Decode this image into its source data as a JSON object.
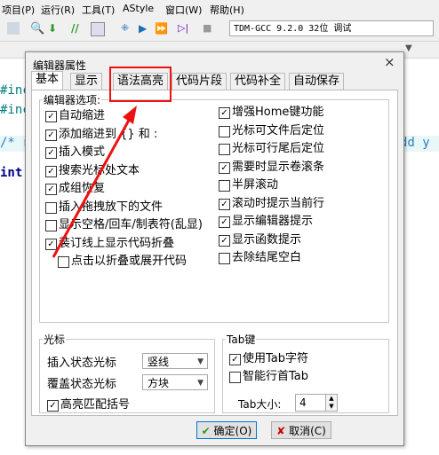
{
  "ide": {
    "menu": [
      "项目(P)",
      "运行(R)",
      "工具(T)",
      "AStyle",
      "窗口(W)",
      "帮助(H)"
    ],
    "compiler": "TDM-GCC 9.2.0 32位 调试",
    "code_fragments": [
      "#inc",
      "#inc",
      "/* r",
      "int",
      "dd y"
    ]
  },
  "dialog": {
    "title": "编辑器属性",
    "close_symbol": "×",
    "tabs": [
      "基本",
      "显示",
      "语法高亮",
      "代码片段",
      "代码补全",
      "自动保存"
    ],
    "active_tab": "基本",
    "highlighted_tab": "语法高亮",
    "editor_options": {
      "title": "编辑器选项:",
      "left": [
        {
          "label": "自动缩进",
          "checked": true
        },
        {
          "label": "添加缩进到 {} 和 :",
          "checked": true
        },
        {
          "label": "插入模式",
          "checked": true
        },
        {
          "label": "搜索光标处文本",
          "checked": true
        },
        {
          "label": "成组恢复",
          "checked": true
        },
        {
          "label": "插入拖拽放下的文件",
          "checked": false
        },
        {
          "label": "显示空格/回车/制表符(乱显)",
          "checked": false
        },
        {
          "label": "装订线上显示代码折叠",
          "checked": true
        },
        {
          "label": "点击以折叠或展开代码",
          "checked": false
        }
      ],
      "right": [
        {
          "label": "增强Home键功能",
          "checked": true
        },
        {
          "label": "光标可文件后定位",
          "checked": false
        },
        {
          "label": "光标可行尾后定位",
          "checked": false
        },
        {
          "label": "需要时显示卷滚条",
          "checked": true
        },
        {
          "label": "半屏滚动",
          "checked": false
        },
        {
          "label": "滚动时提示当前行",
          "checked": true
        },
        {
          "label": "显示编辑器提示",
          "checked": true
        },
        {
          "label": "显示函数提示",
          "checked": true
        },
        {
          "label": "去除结尾空白",
          "checked": false
        }
      ]
    },
    "cursor": {
      "title": "光标",
      "insert_label": "插入状态光标",
      "insert_value": "竖线",
      "overwrite_label": "覆盖状态光标",
      "overwrite_value": "方块",
      "match_braces": {
        "label": "高亮匹配括号",
        "checked": true
      }
    },
    "tab_key": {
      "title": "Tab键",
      "use_tab": {
        "label": "使用Tab字符",
        "checked": true
      },
      "smart_tab": {
        "label": "智能行首Tab",
        "checked": false
      },
      "size_label": "Tab大小:",
      "size_value": "4"
    },
    "ok_label": "确定(O)",
    "cancel_label": "取消(C)"
  },
  "colors": {
    "highlight_box": "#ee1111",
    "accent": "#0078d7",
    "check_ok": "#2a9a2a",
    "cancel_x": "#cc0000"
  }
}
